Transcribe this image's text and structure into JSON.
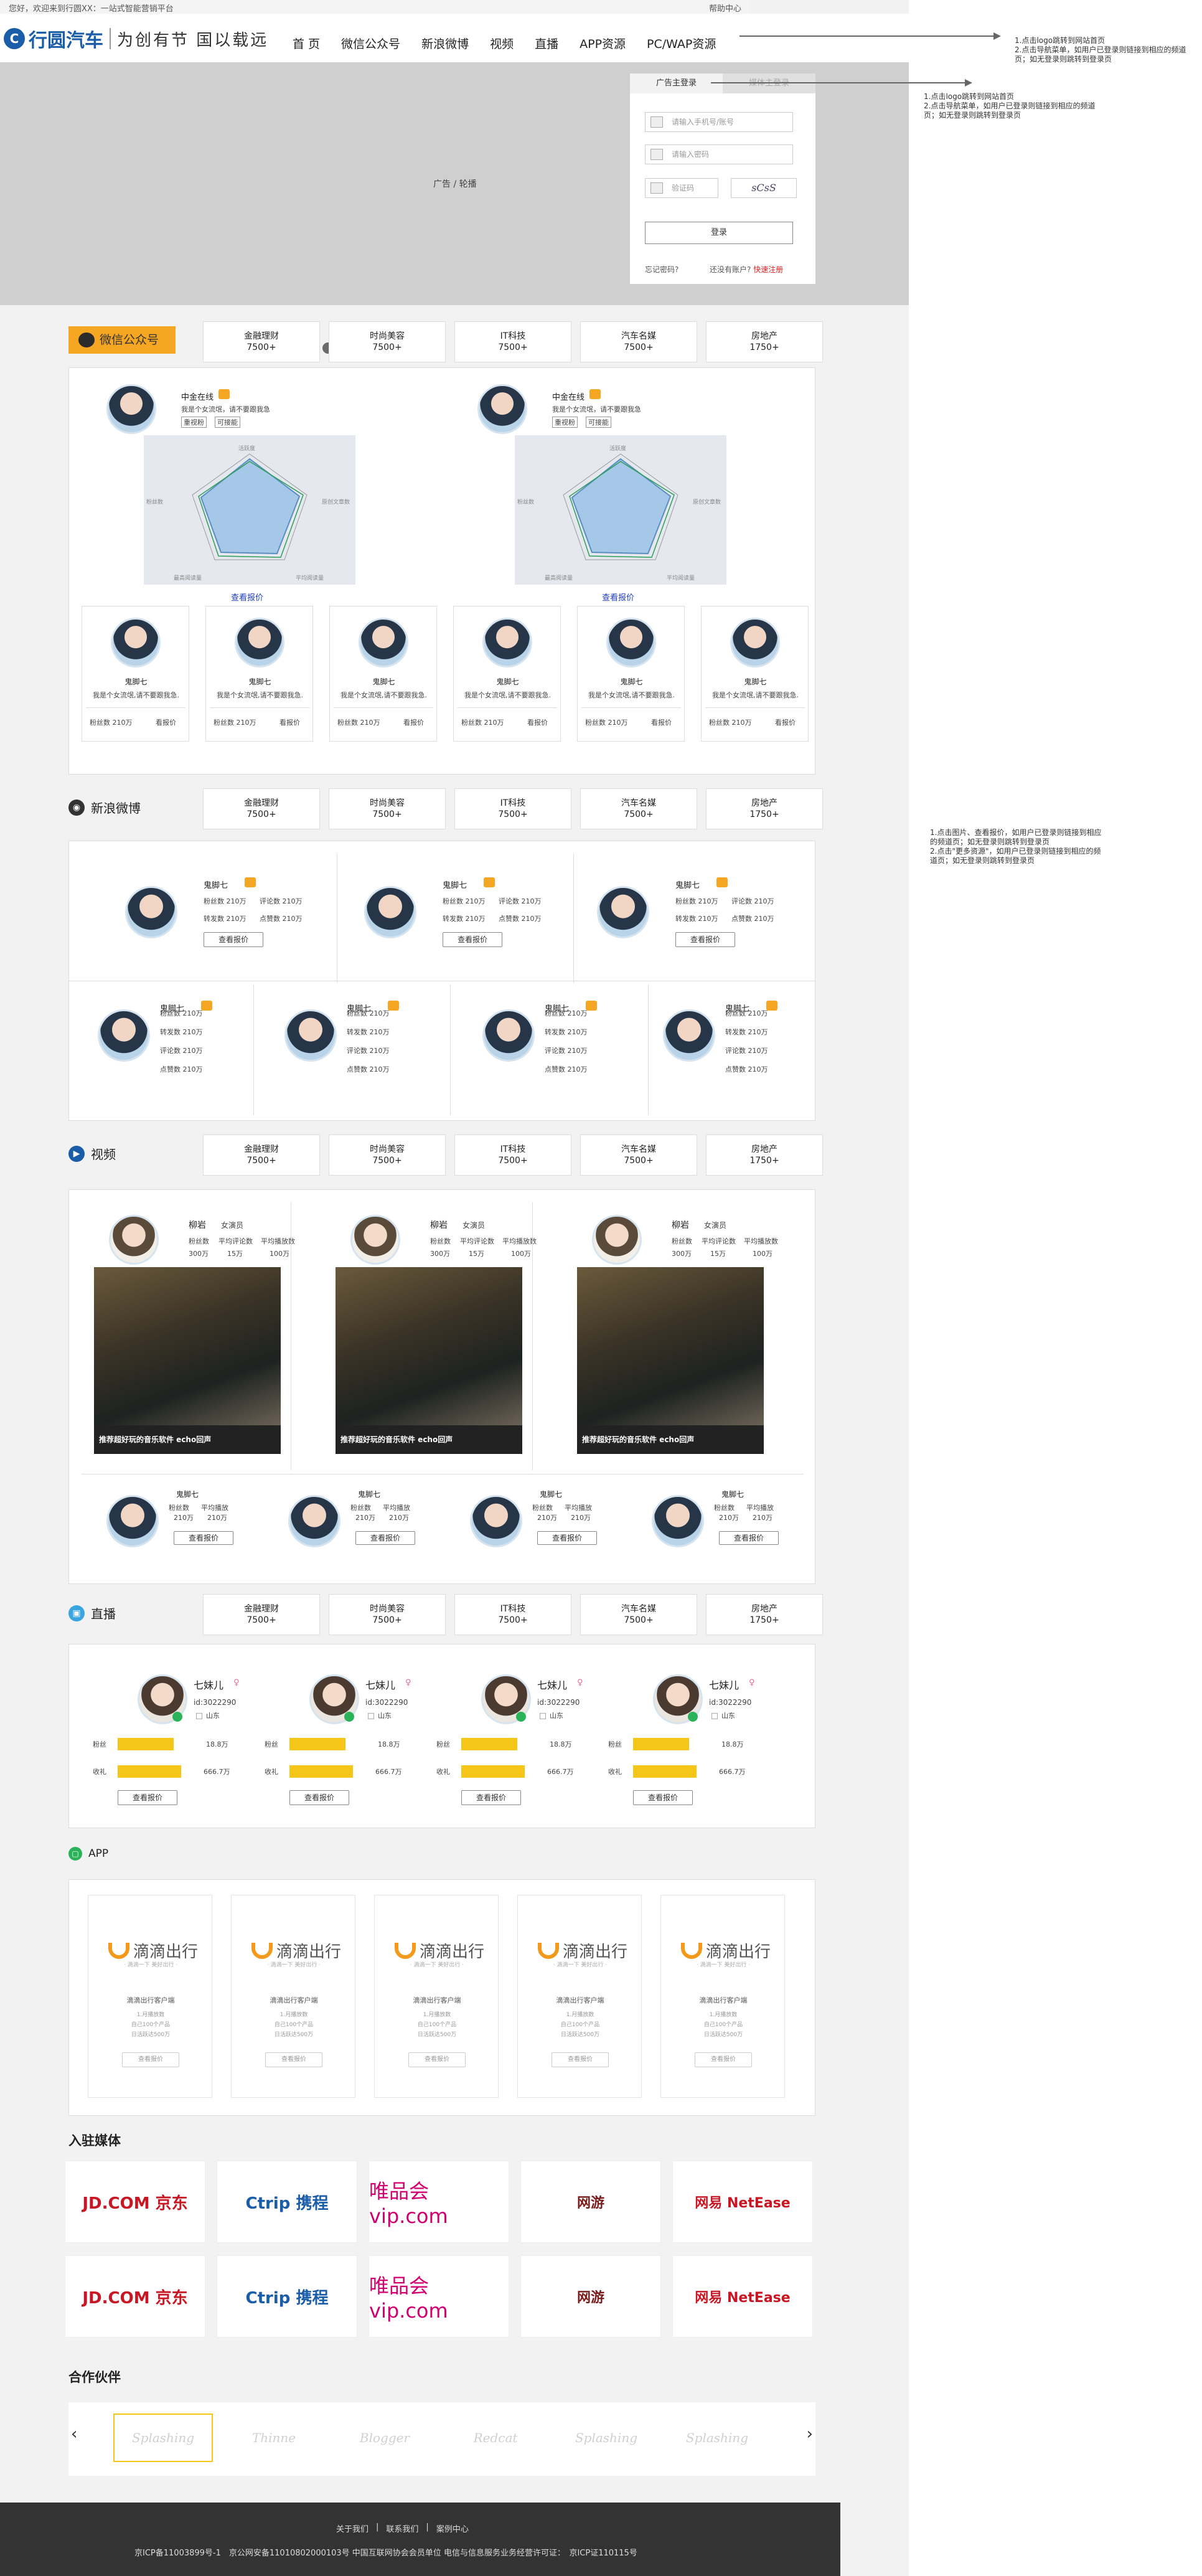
{
  "topbar": {
    "greeting": "您好，欢迎来到行圆XX：一站式智能营销平台",
    "help": "帮助中心"
  },
  "header": {
    "brand": "行圆汽车",
    "slogan": "为创有节 国以载远"
  },
  "nav": [
    "首 页",
    "微信公众号",
    "新浪微博",
    "视频",
    "直播",
    "APP资源",
    "PC/WAP资源"
  ],
  "banner": {
    "caption": "广告 / 轮播"
  },
  "login": {
    "tab_active": "广告主登录",
    "tab_inactive": "媒体主登录",
    "phone_placeholder": "请输入手机号/账号",
    "password_placeholder": "请输入密码",
    "captcha_placeholder": "验证码",
    "captcha_text": "sCsS",
    "submit": "登录",
    "forgot": "忘记密码?",
    "no_account": "还没有账户?",
    "register": "快速注册"
  },
  "annotations": {
    "a1": [
      "1.点击logo跳转到网站首页",
      "2.点击导航菜单，如用户已登录则链接到相应的频道",
      "页；如无登录则跳转到登录页"
    ],
    "a2": [
      "1.点击logo跳转到网站首页",
      "2.点击导航菜单，如用户已登录则链接到相应的频道",
      "页；如无登录则跳转到登录页"
    ],
    "a3": [
      "1.点击图片、查看报价，如用户已登录则链接到相应",
      "的频道页；如无登录则跳转到登录页",
      "2.点击\"更多资源\"，如用户已登录则链接到相应的频",
      "道页；如无登录则跳转到登录页"
    ]
  },
  "categories": [
    [
      "金融理财",
      "7500+"
    ],
    [
      "时尚美容",
      "7500+"
    ],
    [
      "IT科技",
      "7500+"
    ],
    [
      "汽车名媒",
      "7500+"
    ],
    [
      "房地产",
      "1750+"
    ]
  ],
  "wechat": {
    "title": "微信公众号",
    "featured": [
      {
        "name": "中金在线",
        "desc": "我是个女流氓，请不要跟我急",
        "tags": [
          "重视粉",
          "可接能"
        ],
        "link": "查看报价"
      },
      {
        "name": "中金在线",
        "desc": "我是个女流氓，请不要跟我急",
        "tags": [
          "重视粉",
          "可接能"
        ],
        "link": "查看报价"
      }
    ],
    "radar_axes": [
      "活跃度",
      "原创文章数",
      "平均阅读量",
      "最高阅读量",
      "粉丝数",
      "单号阅读量"
    ],
    "cards": {
      "name": "鬼脚七",
      "desc": "我是个女流氓,请不要跟我急.",
      "fans": "粉丝数 210万",
      "btn": "看报价"
    }
  },
  "weibo": {
    "title": "新浪微博",
    "name": "鬼脚七",
    "l1": "粉丝数 210万",
    "l2": "评论数 210万",
    "l3": "转发数 210万",
    "l4": "点赞数 210万",
    "btn": "查看报价"
  },
  "video": {
    "title": "视频",
    "star": {
      "name": "柳岩",
      "role": "女演员",
      "h1": "粉丝数",
      "h2": "平均评论数",
      "h3": "平均播放数",
      "v1": "300万",
      "v2": "15万",
      "v3": "100万",
      "caption": "推荐超好玩的音乐软件 echo回声"
    },
    "small": {
      "name": "鬼脚七",
      "h1": "粉丝数",
      "h2": "平均播放",
      "v1": "210万",
      "v2": "210万",
      "btn": "查看报价"
    }
  },
  "live": {
    "title": "直播",
    "name": "七妹儿",
    "id": "id:3022290",
    "loc": "山东",
    "fans_label": "粉丝",
    "fans_value": "18.8万",
    "gift_label": "收礼",
    "gift_value": "666.7万",
    "fans_ratio": 0.75,
    "gift_ratio": 0.85,
    "btn": "查看报价"
  },
  "app": {
    "title": "APP",
    "brand": "滴滴出行",
    "sub": "· 滴滴一下 美好出行 ·",
    "name": "滴滴出行客户端",
    "l1": "1.月播放数",
    "l2": "自己100个产品",
    "l3": "日活跃达500万",
    "btn": "查看报价"
  },
  "media": {
    "title": "入驻媒体",
    "logos": [
      "JD.COM 京东",
      "Ctrip 携程",
      "唯品会 vip.com",
      "网游",
      "网易 NetEase"
    ]
  },
  "partners": {
    "title": "合作伙伴",
    "items": [
      "Splashing",
      "Thinne",
      "Blogger",
      "Redcat",
      "Splashing",
      "Splashing"
    ]
  },
  "footer": {
    "links": [
      "关于我们",
      "联系我们",
      "案例中心"
    ],
    "icp": "京ICP备11003899号-1　京公网安备11010802000103号 中国互联网协会会员单位 电信与信息服务业务经营许可证：　京ICP证110115号"
  },
  "colors": {
    "accent": "#f5a623",
    "bar": "#f5c518",
    "nav_text": "#222",
    "link": "#2040c0",
    "register": "#e02020"
  }
}
